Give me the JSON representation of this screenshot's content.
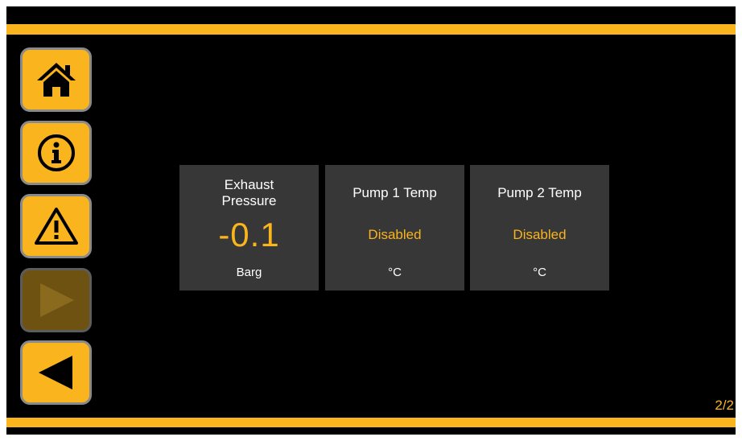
{
  "colors": {
    "accent": "#f9b41e",
    "background": "#000000",
    "tile": "#373737",
    "disabled_button": "#6e5212"
  },
  "nav": [
    {
      "id": "home",
      "icon": "home-icon",
      "enabled": true
    },
    {
      "id": "info",
      "icon": "info-icon",
      "enabled": true
    },
    {
      "id": "warning",
      "icon": "warning-icon",
      "enabled": true
    },
    {
      "id": "next",
      "icon": "play-right-icon",
      "enabled": false
    },
    {
      "id": "back",
      "icon": "back-left-icon",
      "enabled": true
    }
  ],
  "tiles": [
    {
      "title": "Exhaust Pressure",
      "value": "-0.1",
      "unit": "Barg"
    },
    {
      "title": "Pump 1 Temp",
      "value": "Disabled",
      "unit": "°C"
    },
    {
      "title": "Pump 2 Temp",
      "value": "Disabled",
      "unit": "°C"
    }
  ],
  "page_indicator": "2/2"
}
